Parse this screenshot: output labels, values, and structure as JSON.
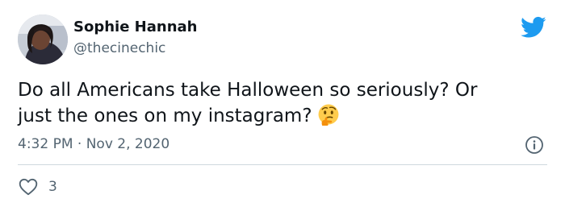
{
  "author": {
    "display_name": "Sophie Hannah",
    "handle": "@thecinechic"
  },
  "tweet": {
    "text_line1": "Do all Americans take Halloween so seriously? Or",
    "text_line2": "just the ones on my instagram?",
    "emoji": "thinking-face",
    "timestamp": "4:32 PM · Nov 2, 2020"
  },
  "engagement": {
    "likes": "3"
  },
  "colors": {
    "twitter_blue": "#1d9bf0",
    "secondary_text": "#536471",
    "primary_text": "#0f1419",
    "divider": "#cfd9de"
  },
  "icons": {
    "logo": "twitter-bird-icon",
    "info": "info-icon",
    "like": "heart-icon"
  }
}
